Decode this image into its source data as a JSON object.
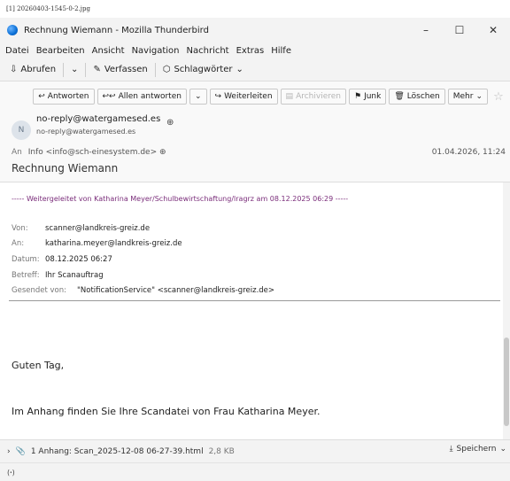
{
  "file_label": "[1] 20260403-1545-0-2.jpg",
  "window": {
    "title": "Rechnung Wiemann - Mozilla Thunderbird",
    "controls": [
      "–",
      "☐",
      "✕"
    ]
  },
  "menu": [
    "Datei",
    "Bearbeiten",
    "Ansicht",
    "Navigation",
    "Nachricht",
    "Extras",
    "Hilfe"
  ],
  "toolbar": {
    "get_mail": "Abrufen",
    "compose": "Verfassen",
    "tags": "Schlagwörter"
  },
  "actions": {
    "reply": "Antworten",
    "reply_all": "Allen antworten",
    "forward": "Weiterleiten",
    "archive": "Archivieren",
    "junk": "Junk",
    "delete": "Löschen",
    "more": "Mehr"
  },
  "header": {
    "avatar_initial": "N",
    "from_name": "no-reply@watergamesed.es",
    "from_address": "no-reply@watergamesed.es",
    "to_label": "An",
    "to_value": "Info <info@sch-einesystem.de>",
    "date": "01.04.2026, 11:24",
    "subject": "Rechnung Wiemann"
  },
  "message": {
    "forward_header": "----- Weitergeleitet von Katharina Meyer/Schulbewirtschaftung/lragrz am 08.12.2025 06:29 -----",
    "fields": [
      {
        "label": "Von:",
        "value": "scanner@landkreis-greiz.de"
      },
      {
        "label": "An:",
        "value": "katharina.meyer@landkreis-greiz.de"
      },
      {
        "label": "Datum:",
        "value": "08.12.2025 06:27"
      },
      {
        "label": "Betreff:",
        "value": "Ihr Scanauftrag"
      },
      {
        "label": "Gesendet von:",
        "value": "\"NotificationService\" <scanner@landkreis-greiz.de>"
      }
    ],
    "greeting": "Guten Tag,",
    "paragraph": "Im Anhang finden Sie Ihre Scandatei von Frau Katharina Meyer."
  },
  "attachment": {
    "label": "1 Anhang: Scan_2025-12-08 06-27-39.html",
    "size": "2,8 KB",
    "save": "Speichern"
  },
  "status": "(ꞏ)"
}
